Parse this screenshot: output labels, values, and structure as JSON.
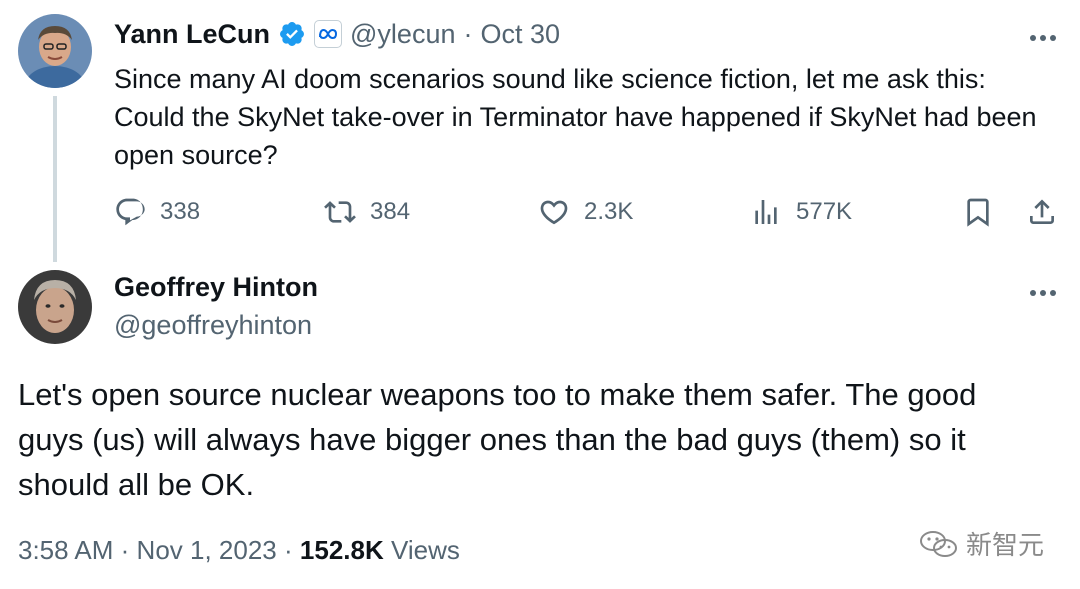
{
  "tweet1": {
    "author_name": "Yann LeCun",
    "handle": "@ylecun",
    "separator": "·",
    "date": "Oct 30",
    "text": "Since many AI doom scenarios sound like science fiction, let me ask this: Could the SkyNet take-over in Terminator have happened if SkyNet had been open source?",
    "replies": "338",
    "reposts": "384",
    "likes": "2.3K",
    "views": "577K",
    "icons": [
      "verified-badge-icon",
      "meta-affiliate-icon",
      "more-icon",
      "reply-icon",
      "repost-icon",
      "like-icon",
      "views-icon",
      "bookmark-icon",
      "share-icon"
    ]
  },
  "tweet2": {
    "author_name": "Geoffrey Hinton",
    "handle": "@geoffreyhinton",
    "text": "Let's open source nuclear weapons too to make them safer. The good guys (us) will always have bigger ones than the bad guys (them) so it should all be OK.",
    "time": "3:58 AM",
    "sep1": "·",
    "date": "Nov 1, 2023",
    "sep2": "·",
    "views_count": "152.8K",
    "views_label": "Views"
  },
  "watermark": {
    "text": "新智元"
  },
  "colors": {
    "primary_text": "#0f1419",
    "secondary_text": "#536471",
    "verified": "#1d9bf0",
    "thread_line": "#cfd9de"
  }
}
